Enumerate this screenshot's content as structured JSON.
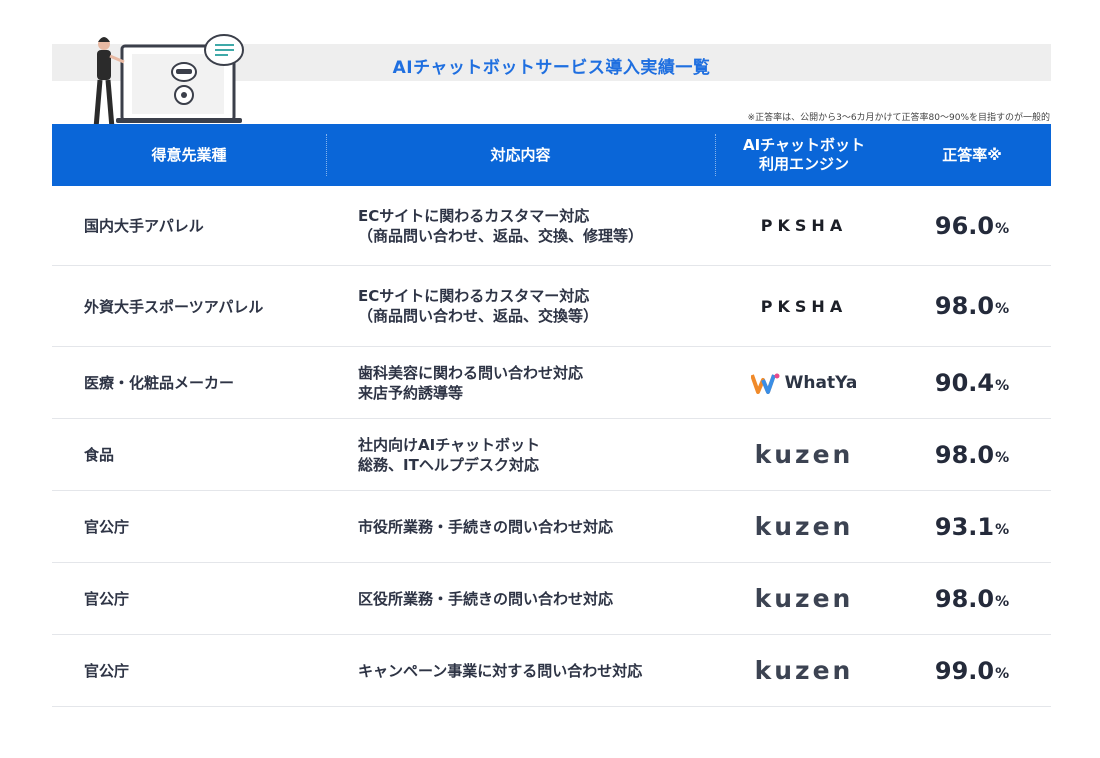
{
  "title": "AIチャットボットサービス導入実績一覧",
  "note": "※正答率は、公開から3〜6カ月かけて正答率80〜90%を目指すのが一般的",
  "headers": {
    "industry": "得意先業種",
    "content": "対応内容",
    "engine_line1": "AIチャットボット",
    "engine_line2": "利用エンジン",
    "rate": "正答率※"
  },
  "rows": [
    {
      "industry": "国内大手アパレル",
      "desc1": "ECサイトに関わるカスタマー対応",
      "desc2": "（商品問い合わせ、返品、交換、修理等）",
      "engine": "PKSHA",
      "rate": "96.0",
      "unit": "%"
    },
    {
      "industry": "外資大手スポーツアパレル",
      "desc1": "ECサイトに関わるカスタマー対応",
      "desc2": "（商品問い合わせ、返品、交換等）",
      "engine": "PKSHA",
      "rate": "98.0",
      "unit": "%"
    },
    {
      "industry": "医療・化粧品メーカー",
      "desc1": "歯科美容に関わる問い合わせ対応",
      "desc2": "来店予約誘導等",
      "engine": "WhatYa",
      "rate": "90.4",
      "unit": "%"
    },
    {
      "industry": "食品",
      "desc1": "社内向けAIチャットボット",
      "desc2": "総務、ITヘルプデスク対応",
      "engine": "kuzen",
      "rate": "98.0",
      "unit": "%"
    },
    {
      "industry": "官公庁",
      "desc1": "市役所業務・手続きの問い合わせ対応",
      "desc2": "",
      "engine": "kuzen",
      "rate": "93.1",
      "unit": "%"
    },
    {
      "industry": "官公庁",
      "desc1": "区役所業務・手続きの問い合わせ対応",
      "desc2": "",
      "engine": "kuzen",
      "rate": "98.0",
      "unit": "%"
    },
    {
      "industry": "官公庁",
      "desc1": "キャンペーン事業に対する問い合わせ対応",
      "desc2": "",
      "engine": "kuzen",
      "rate": "99.0",
      "unit": "%"
    }
  ],
  "colors": {
    "header_bg": "#0a66d8",
    "title": "#1f6fe0",
    "kuzen_accent": "#3fa9a8"
  }
}
